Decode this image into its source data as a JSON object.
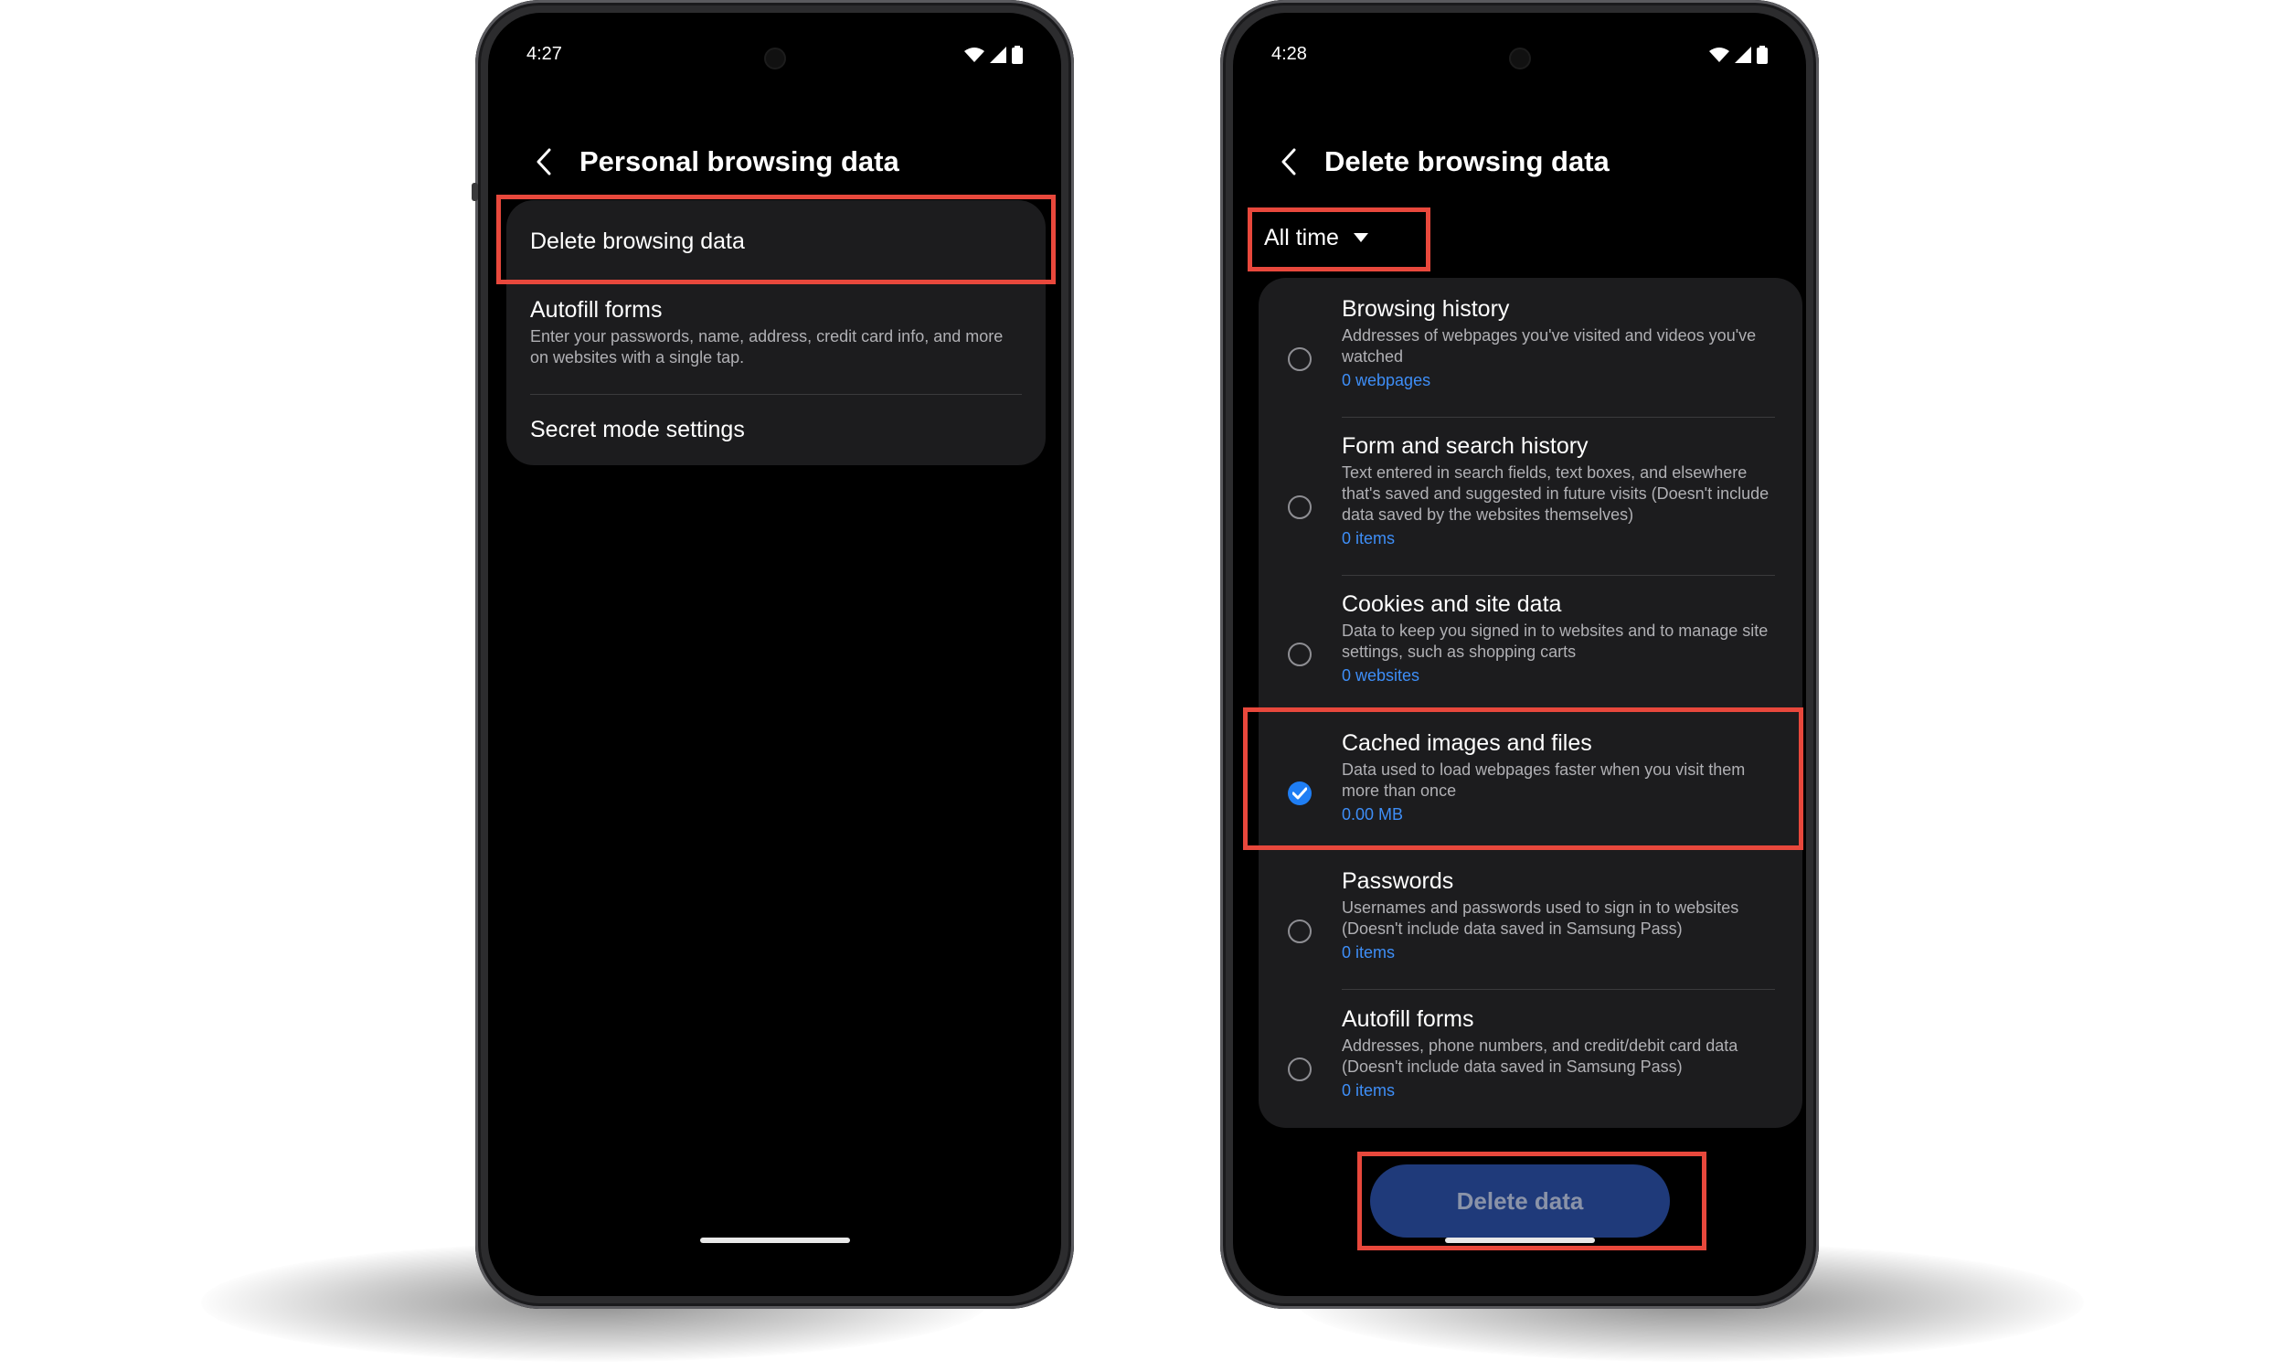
{
  "left_phone": {
    "status": {
      "time": "4:27"
    },
    "title": "Personal browsing data",
    "items": [
      {
        "title": "Delete browsing data",
        "subtitle": ""
      },
      {
        "title": "Autofill forms",
        "subtitle": "Enter your passwords, name, address, credit card info, and more on websites with a single tap."
      },
      {
        "title": "Secret mode settings",
        "subtitle": ""
      }
    ]
  },
  "right_phone": {
    "status": {
      "time": "4:28"
    },
    "title": "Delete browsing data",
    "period": {
      "label": "All time"
    },
    "options": [
      {
        "title": "Browsing history",
        "subtitle": "Addresses of webpages you've visited and videos you've watched",
        "count": "0 webpages",
        "checked": false
      },
      {
        "title": "Form and search history",
        "subtitle": "Text entered in search fields, text boxes, and elsewhere that's saved and suggested in future visits (Doesn't include data saved by the websites themselves)",
        "count": "0 items",
        "checked": false
      },
      {
        "title": "Cookies and site data",
        "subtitle": "Data to keep you signed in to websites and to manage site settings, such as shopping carts",
        "count": "0 websites",
        "checked": false
      },
      {
        "title": "Cached images and files",
        "subtitle": "Data used to load webpages faster when you visit them more than once",
        "count": "0.00 MB",
        "checked": true
      },
      {
        "title": "Passwords",
        "subtitle": "Usernames and passwords used to sign in to websites (Doesn't include data saved in Samsung Pass)",
        "count": "0 items",
        "checked": false
      },
      {
        "title": "Autofill forms",
        "subtitle": "Addresses, phone numbers, and credit/debit card data (Doesn't include data saved in Samsung Pass)",
        "count": "0 items",
        "checked": false
      }
    ],
    "delete_button": {
      "label": "Delete data"
    }
  },
  "colors": {
    "highlight": "#e8483c",
    "accent": "#1f7ef4",
    "link": "#3e8ef7",
    "card": "#1c1c1e"
  },
  "icons": [
    "back-arrow-icon",
    "wifi-icon",
    "signal-icon",
    "battery-icon",
    "dropdown-caret-icon",
    "checkmark-icon"
  ]
}
